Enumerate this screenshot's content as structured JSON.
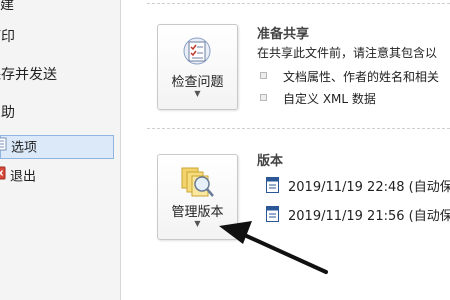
{
  "sidebar": {
    "items": [
      {
        "label": "新建"
      },
      {
        "label": "打印"
      },
      {
        "label": "保存并发送"
      },
      {
        "label": "帮助"
      },
      {
        "label": "选项"
      },
      {
        "label": "退出"
      }
    ]
  },
  "inspect": {
    "button_label": "检查问题",
    "title": "准备共享",
    "description": "在共享此文件前，请注意其包含以",
    "bullets": [
      "文档属性、作者的姓名和相关",
      "自定义 XML 数据"
    ]
  },
  "versions": {
    "button_label": "管理版本",
    "title": "版本",
    "items": [
      {
        "label": "2019/11/19 22:48 (自动保"
      },
      {
        "label": "2019/11/19 21:56 (自动保"
      }
    ]
  },
  "colors": {
    "accent": "#2b5797",
    "selected_bg": "#dbe9f8",
    "exit_red": "#c0392b"
  }
}
